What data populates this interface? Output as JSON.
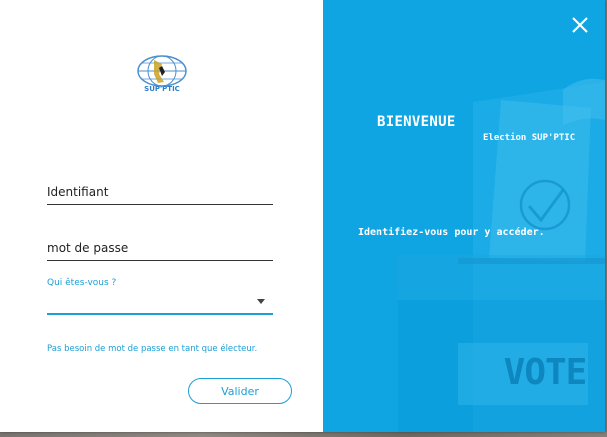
{
  "logo": {
    "text": "SUP'PTIC"
  },
  "form": {
    "identifier_value": "Identifiant",
    "password_value": "mot de passe",
    "role_label": "Qui êtes-vous ?",
    "role_value": "",
    "note": "Pas besoin de mot de passe en tant que  électeur.",
    "submit_label": "Valider"
  },
  "welcome_panel": {
    "title": "BIENVENUE",
    "subtitle": "Election SUP'PTIC",
    "instruction": "Identifiez-vous pour y accéder.",
    "vote_text": "VOTE"
  },
  "colors": {
    "panel_blue": "#0ea5e2",
    "accent": "#1c9fd6",
    "white": "#ffffff"
  },
  "icons": {
    "close": "close-icon",
    "dropdown": "chevron-down-icon",
    "checkmark": "checkmark-icon"
  }
}
